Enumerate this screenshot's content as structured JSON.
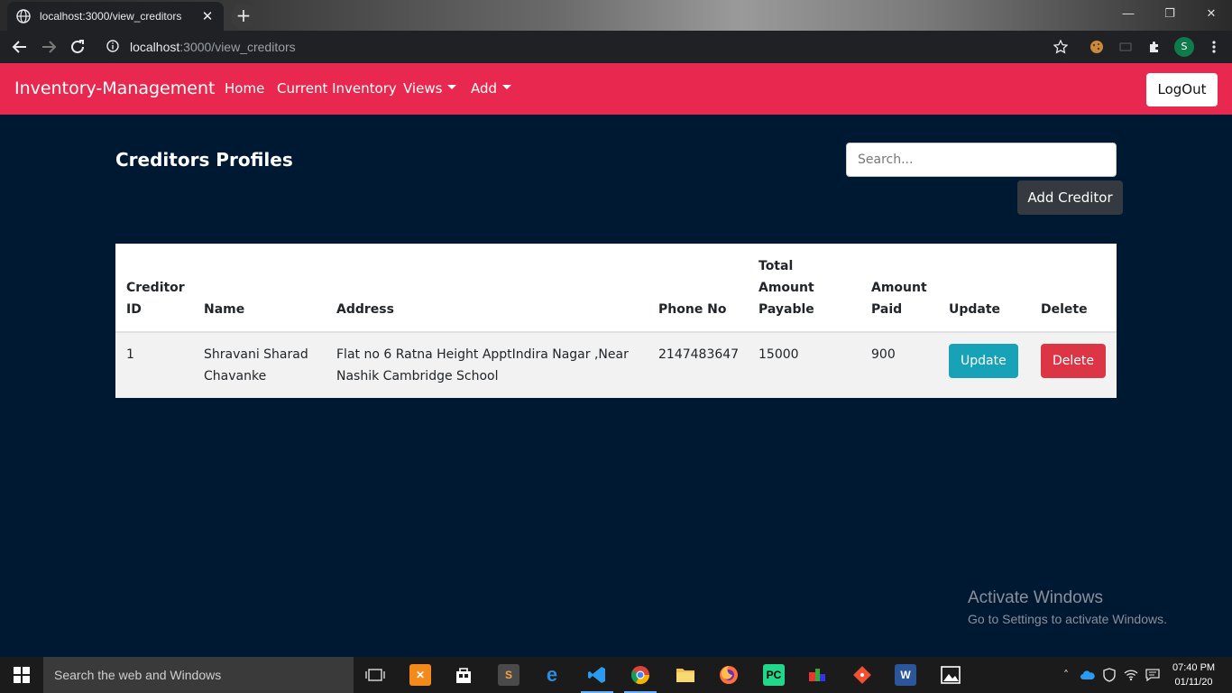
{
  "browser": {
    "tab_title": "localhost:3000/view_creditors",
    "url_host": "localhost",
    "url_path": ":3000/view_creditors"
  },
  "navbar": {
    "brand": "Inventory-Management",
    "links": [
      "Home",
      "Current Inventory",
      "Views",
      "Add"
    ],
    "logout": "LogOut",
    "color": "#e8284f"
  },
  "main": {
    "title": "Creditors Profiles",
    "search_placeholder": "Search...",
    "add_button": "Add Creditor",
    "background": "#001933"
  },
  "table": {
    "headers": [
      "Creditor ID",
      "Name",
      "Address",
      "Phone No",
      "Total Amount Payable",
      "Amount Paid",
      "Update",
      "Delete"
    ],
    "rows": [
      {
        "id": "1",
        "name": "Shravani Sharad Chavanke",
        "address": "Flat no 6 Ratna Height ApptIndira Nagar ,Near Nashik Cambridge School",
        "phone": "2147483647",
        "total_payable": "15000",
        "amount_paid": "900",
        "update_label": "Update",
        "delete_label": "Delete"
      }
    ]
  },
  "watermark": {
    "title": "Activate Windows",
    "subtitle": "Go to Settings to activate Windows."
  },
  "taskbar": {
    "search_placeholder": "Search the web and Windows",
    "time": "07:40 PM",
    "date": "01/11/20"
  }
}
